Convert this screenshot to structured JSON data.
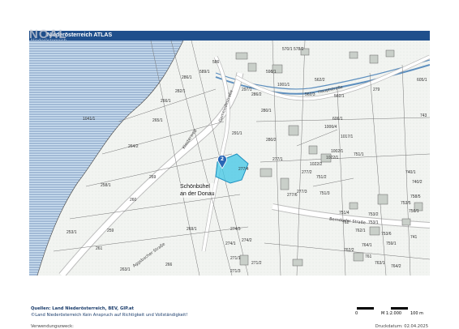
{
  "header": {
    "title": "Niederösterreich ATLAS",
    "watermark": "NOAL",
    "watermark_sub": "Niederösterreich"
  },
  "map": {
    "place_label_1": "Schönbühel",
    "place_label_2": "an der Donau",
    "road_labels": [
      "Klosterweg",
      "Berndorfer Straße",
      "Aggsbacher Straße",
      "Gemeindestraße",
      "Hauptstraße"
    ],
    "marker_number": "2",
    "parcels": [
      "1041/1",
      "282/1",
      "280/1",
      "286/1",
      "279",
      "277/1",
      "277/2",
      "277/3",
      "277/6",
      "274/1",
      "274/2",
      "274/3",
      "271/1",
      "271/2",
      "271/3",
      "266/1",
      "265/1",
      "264/2",
      "260",
      "259",
      "258/1",
      "253/1",
      "261",
      "263/1",
      "266",
      "269",
      "269/1",
      "751/1",
      "751/2",
      "751/3",
      "751/4",
      "753/1",
      "753/2",
      "753/5",
      "756/1",
      "758/5",
      "740/1",
      "740/2",
      "743",
      "741",
      "605/1",
      "606/1",
      "570/1",
      "578/2",
      "586",
      "589/1",
      "598/1",
      "562/2",
      "562/3",
      "562/1",
      "1002/1",
      "1006/4",
      "1022/1",
      "1022/2",
      "280/2",
      "297/1",
      "286/2",
      "1001/1",
      "764/1",
      "762",
      "762/1",
      "762/2",
      "761",
      "763/1",
      "764/2",
      "759/1",
      "753/6",
      "1017/1",
      "291/1",
      "277/4"
    ],
    "colors": {
      "water": "#c8dff1",
      "water_hatch": "#6f8fb8",
      "land": "#f4f5f3",
      "highlight": "#3fc7e6",
      "header": "#1f4f8c"
    }
  },
  "scale": {
    "ratio": "M 1:2.000",
    "zero": "0",
    "max": "100 m"
  },
  "footer": {
    "sources": "Quellen: Land Niederösterreich, BEV, GIP.at",
    "copyright": "©Land Niederösterreich Kein Anspruch auf Richtigkeit und Vollständigkeit!",
    "purpose_label": "Verwendungszweck:",
    "print_date": "Druckdatum: 02.04.2025"
  }
}
